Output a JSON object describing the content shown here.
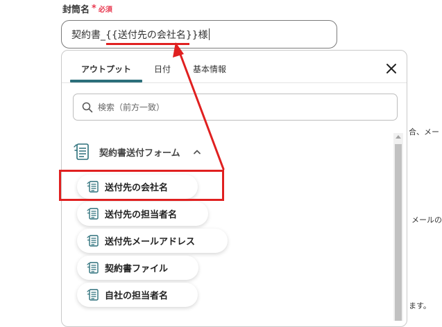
{
  "field": {
    "label": "封筒名",
    "required_mark": "*",
    "required_text": "必須",
    "value_prefix": "契約書_",
    "value_token": "{{送付先の会社名}}",
    "value_suffix": "様"
  },
  "panel": {
    "tabs": [
      {
        "label": "アウトプット",
        "active": true
      },
      {
        "label": "日付",
        "active": false
      },
      {
        "label": "基本情報",
        "active": false
      }
    ],
    "search_placeholder": "検索（前方一致）",
    "section_title": "契約書送付フォーム",
    "items": [
      {
        "label": "送付先の会社名",
        "highlighted": true
      },
      {
        "label": "送付先の担当者名",
        "highlighted": false
      },
      {
        "label": "送付先メールアドレス",
        "highlighted": false
      },
      {
        "label": "契約書ファイル",
        "highlighted": false
      },
      {
        "label": "自社の担当者名",
        "highlighted": false
      }
    ]
  },
  "background_text": {
    "line1": "合、メー",
    "line2": "メールの",
    "line3": "ます。"
  },
  "colors": {
    "accent": "#2b6f7a",
    "required": "#e8384f",
    "annotation": "#e02020"
  },
  "icons": {
    "search": "search-icon",
    "close": "close-icon",
    "form": "form-document-icon",
    "chevron": "chevron-up-icon"
  }
}
